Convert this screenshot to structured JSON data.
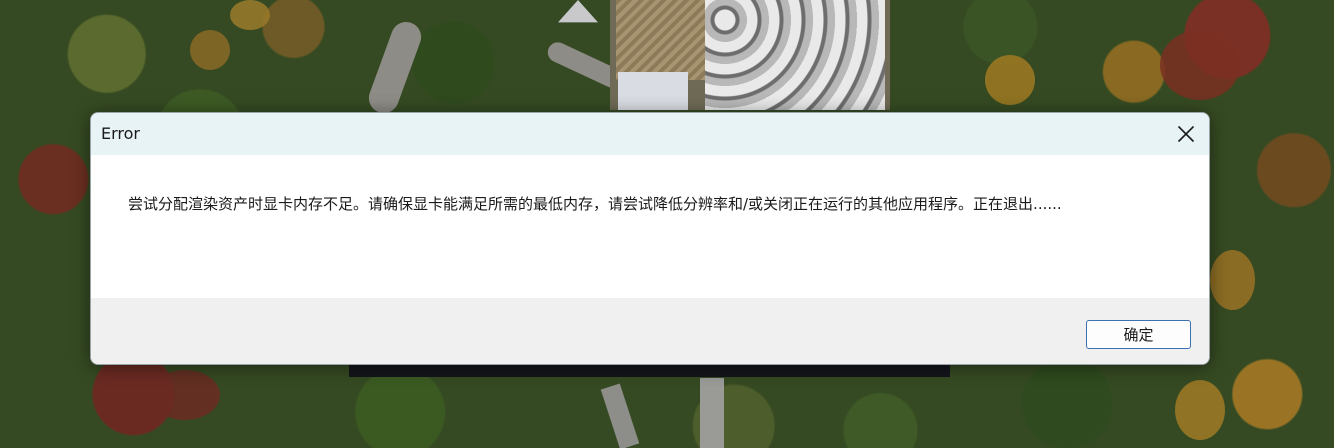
{
  "dialog": {
    "title": "Error",
    "message": "尝试分配渲染资产时显卡内存不足。请确保显卡能满足所需的最低内存，请尝试降低分辨率和/或关闭正在运行的其他应用程序。正在退出......",
    "ok_label": "确定"
  },
  "icons": {
    "close": "close-icon"
  },
  "colors": {
    "titlebar": "#e8f3f6",
    "footer": "#f0f0f0",
    "button_border": "#3d6fb3"
  }
}
